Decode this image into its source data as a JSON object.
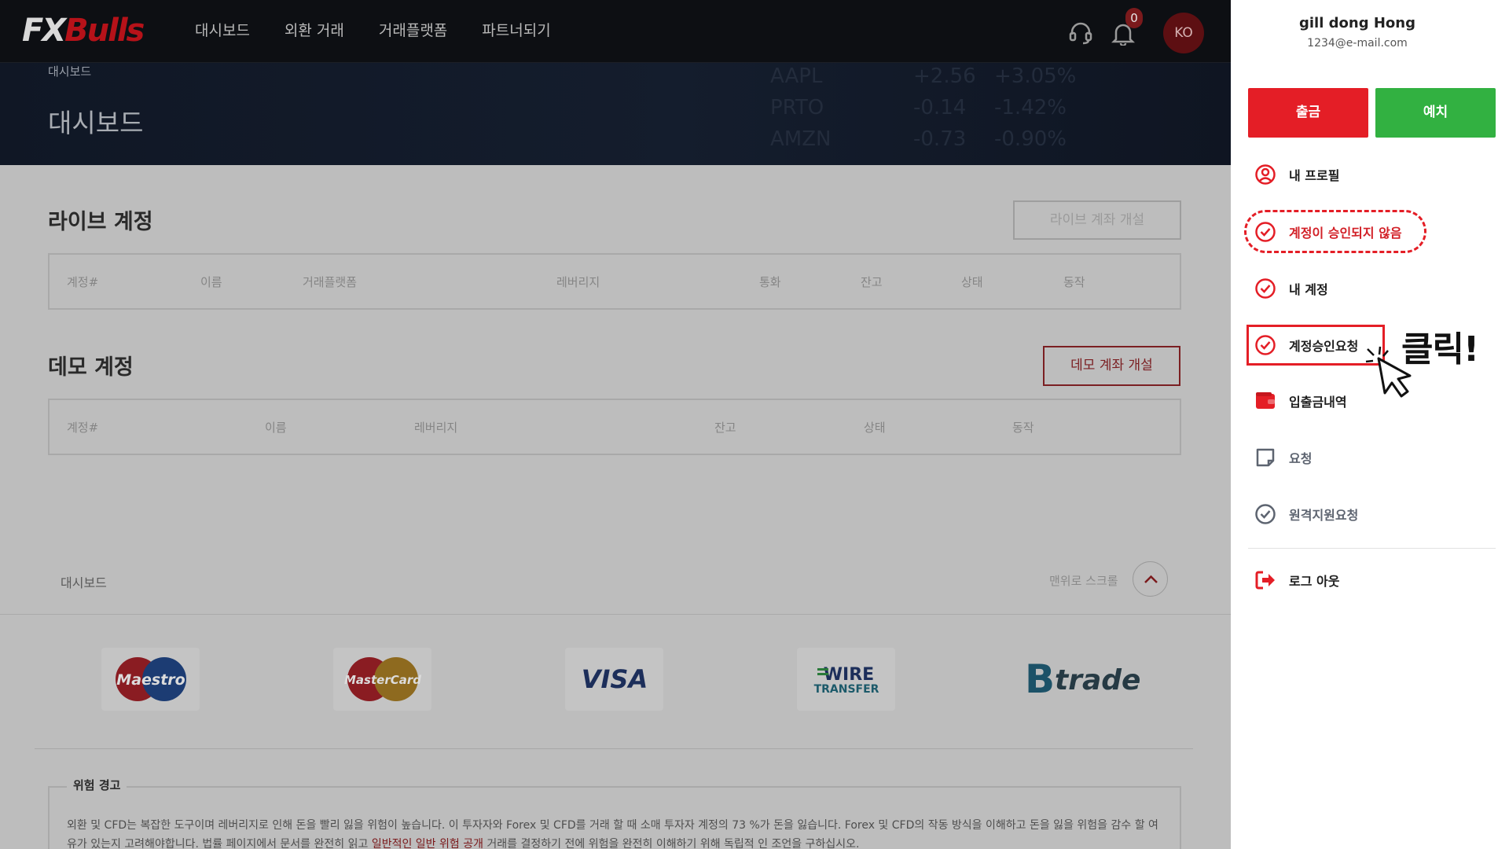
{
  "header": {
    "logo_fx": "FX",
    "logo_bulls": "Bulls",
    "nav": [
      "대시보드",
      "외환 거래",
      "거래플랫폼",
      "파트너되기"
    ],
    "notification_count": "0",
    "language": "KO",
    "icons": [
      "headset-icon",
      "bell-icon"
    ]
  },
  "hero": {
    "breadcrumb": "대시보드",
    "title": "대시보드",
    "tickers": [
      "AAPL",
      "PRTO",
      "AMZN",
      "+2.56",
      "-0.14",
      "-0.73",
      "+3.05%",
      "-1.42%",
      "-0.90%"
    ]
  },
  "live": {
    "title": "라이브 계정",
    "open_button": "라이브 계좌 개설",
    "columns": [
      "계정#",
      "이름",
      "거래플랫폼",
      "레버리지",
      "통화",
      "잔고",
      "상태",
      "동작"
    ]
  },
  "demo": {
    "title": "데모 계정",
    "open_button": "데모 계좌 개설",
    "columns": [
      "계정#",
      "이름",
      "레버리지",
      "잔고",
      "상태",
      "동작"
    ]
  },
  "footer": {
    "left": "대시보드",
    "scroll_top": "맨위로 스크롤"
  },
  "payments": [
    "Maestro",
    "MasterCard",
    "VISA",
    "WIRE",
    "TRANSFER",
    "trade"
  ],
  "risk": {
    "title": "위험 경고",
    "text_1": "외환 및 CFD는 복잡한 도구이며 레버리지로 인해 돈을 빨리 잃을 위험이 높습니다. 이 투자자와 Forex 및 CFD를 거래 할 때 소매 투자자 계정의 73 %가 돈을 잃습니다. Forex 및 CFD의 작동 방식을 이해하고 돈을 잃을 위험을 감수 할 여유가 있는지 고려해야합니다. 법률 페이지에서 문서를 완전히 읽고 ",
    "link": "일반적인 일반 위험 공개",
    "text_2": " 거래를 결정하기 전에 위험을 완전히 이해하기 위해 독립적 인 조언을 구하십시오."
  },
  "side": {
    "user_name": "gill dong Hong",
    "email": "1234@e-mail.com",
    "withdraw": "출금",
    "deposit": "예치",
    "items": [
      {
        "label": "내 프로필",
        "icon": "user-circle-icon"
      },
      {
        "label": "계정이 승인되지 않음",
        "icon": "check-circle-icon"
      },
      {
        "label": "내 계정",
        "icon": "check-circle-icon"
      },
      {
        "label": "계정승인요청",
        "icon": "check-circle-icon"
      },
      {
        "label": "입출금내역",
        "icon": "wallet-icon"
      },
      {
        "label": "요청",
        "icon": "note-icon"
      },
      {
        "label": "원격지원요청",
        "icon": "check-circle-icon"
      },
      {
        "label": "로그 아웃",
        "icon": "logout-icon"
      }
    ],
    "annotation": "클릭!"
  },
  "colors": {
    "accent_red": "#e41e26",
    "deposit_green": "#32b141"
  }
}
